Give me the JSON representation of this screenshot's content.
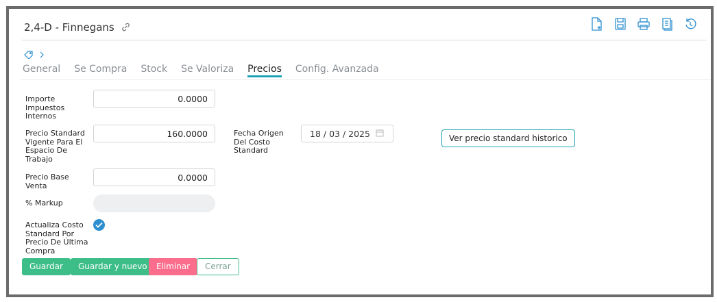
{
  "header": {
    "title": "2,4-D - Finnegans",
    "icons": [
      "link-icon",
      "new-document-icon",
      "save-icon",
      "print-icon",
      "notes-icon",
      "history-icon"
    ]
  },
  "tabs": [
    {
      "label": "General",
      "active": false
    },
    {
      "label": "Se Compra",
      "active": false
    },
    {
      "label": "Stock",
      "active": false
    },
    {
      "label": "Se Valoriza",
      "active": false
    },
    {
      "label": "Precios",
      "active": true
    },
    {
      "label": "Config. Avanzada",
      "active": false
    }
  ],
  "form": {
    "impuestos_label": "Importe Impuestos Internos",
    "impuestos_value": "0.0000",
    "precio_std_label": "Precio Standard Vigente Para El Espacio De Trabajo",
    "precio_std_value": "160.0000",
    "fecha_label": "Fecha Origen Del Costo Standard",
    "fecha_value": "18 / 03 / 2025",
    "historico_button": "Ver precio standard historico",
    "precio_base_label": "Precio Base Venta",
    "precio_base_value": "0.0000",
    "markup_label": "% Markup",
    "markup_value": "",
    "actualiza_label": "Actualiza Costo Standard Por Precio De Última Compra",
    "actualiza_checked": true
  },
  "actions": {
    "guardar": "Guardar",
    "guardar_nuevo": "Guardar y nuevo",
    "eliminar": "Eliminar",
    "cerrar": "Cerrar"
  },
  "colors": {
    "accent": "#1aa3b5",
    "icon_blue": "#2d8fd0",
    "green": "#3dbd87",
    "red": "#fb6d8c"
  }
}
